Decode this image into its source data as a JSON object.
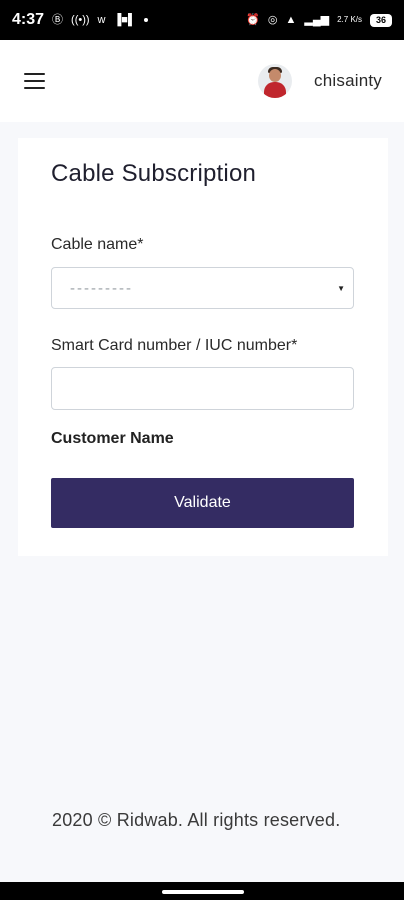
{
  "status_bar": {
    "time": "4:37",
    "right_speed": "2.7\nK/s",
    "battery": "36"
  },
  "navbar": {
    "username": "chisainty"
  },
  "form": {
    "title": "Cable Subscription",
    "cable_label": "Cable name*",
    "cable_placeholder": "---------",
    "smartcard_label": "Smart Card number / IUC number*",
    "smartcard_value": "",
    "customer_label": "Customer Name",
    "validate_label": "Validate"
  },
  "footer": {
    "text": "2020 © Ridwab. All rights reserved."
  },
  "colors": {
    "button": "#342c63",
    "background": "#f7f8fb",
    "status_bar": "#000000"
  },
  "icons": [
    "menu-icon",
    "avatar",
    "dropdown-caret-icon",
    "alarm-icon",
    "wifi-icon",
    "signal-icon",
    "battery-icon"
  ]
}
